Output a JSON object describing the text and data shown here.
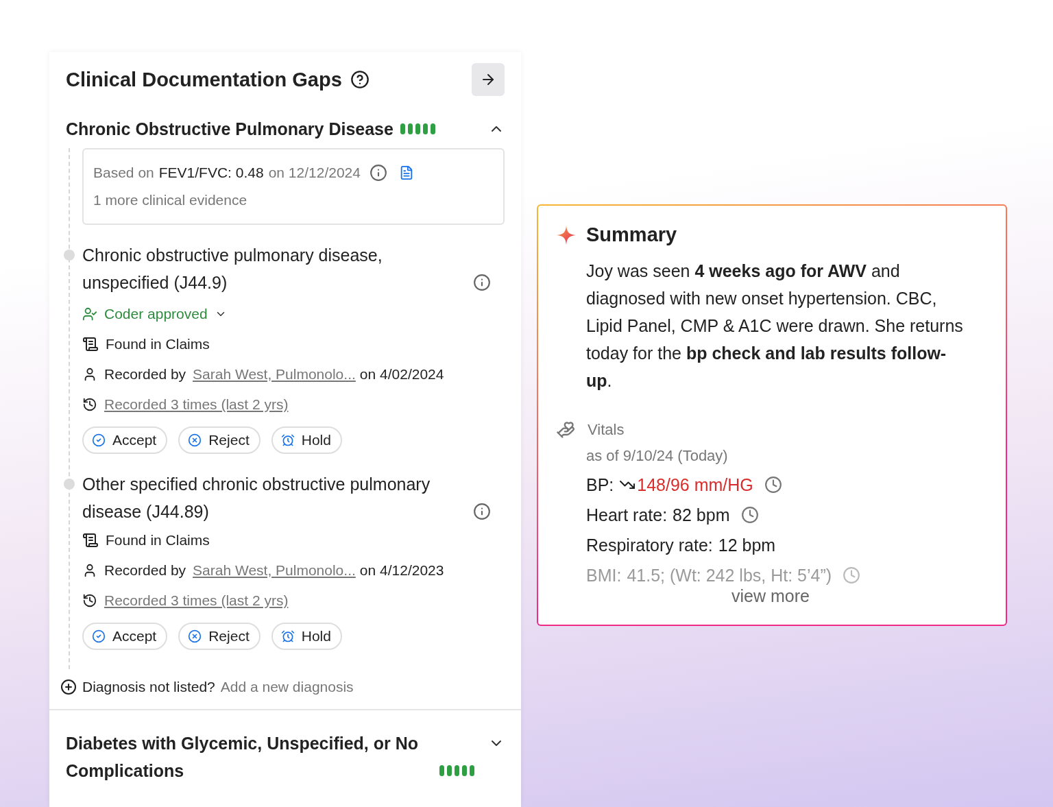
{
  "gaps_panel": {
    "title": "Clinical Documentation Gaps",
    "conditions": [
      {
        "name": "Chronic Obstructive Pulmonary Disease",
        "level": 1,
        "expanded": true,
        "evidence": {
          "prefix": "Based on",
          "value": "FEV1/FVC: 0.48",
          "suffix": "on 12/12/2024",
          "more": "1 more clinical evidence"
        },
        "diagnoses": [
          {
            "name": "Chronic obstructive pulmonary disease, unspecified (J44.9)",
            "status": "Coder approved",
            "source": "Found in Claims",
            "recorded_label": "Recorded by",
            "recorded_by": "Sarah West, Pulmonolo...",
            "recorded_on": "on 4/02/2024",
            "history": "Recorded 3 times (last 2 yrs)",
            "actions": [
              {
                "kind": "accept",
                "label": "Accept"
              },
              {
                "kind": "reject",
                "label": "Reject"
              },
              {
                "kind": "hold",
                "label": "Hold"
              }
            ]
          },
          {
            "name": "Other specified chronic obstructive pulmonary disease (J44.89)",
            "source": "Found in Claims",
            "recorded_label": "Recorded by",
            "recorded_by": "Sarah West, Pulmonolo...",
            "recorded_on": "on 4/12/2023",
            "history": "Recorded 3 times (last 2 yrs)",
            "actions": [
              {
                "kind": "accept",
                "label": "Accept"
              },
              {
                "kind": "reject",
                "label": "Reject"
              },
              {
                "kind": "hold",
                "label": "Hold"
              }
            ]
          }
        ],
        "add": {
          "prompt": "Diagnosis not listed?",
          "link": "Add a new diagnosis"
        }
      },
      {
        "name": "Diabetes with Glycemic, Unspecified, or No Complications",
        "level": 1,
        "expanded": false
      }
    ]
  },
  "summary": {
    "title": "Summary",
    "text": "Joy was seen **4 weeks ago for AWV** and diagnosed with new onset hypertension. CBC, Lipid Panel, CMP & A1C were drawn. She returns today for the **bp check and lab results follow-up**.",
    "vitals": {
      "label": "Vitals",
      "as_of": "as of 9/10/24 (Today)",
      "items": [
        {
          "label": "BP:",
          "value": "148/96 mm/HG",
          "trending_down": true,
          "alert": true,
          "history": true,
          "faded": false
        },
        {
          "label": "Heart rate:",
          "value": "82 bpm",
          "trending_down": false,
          "alert": false,
          "history": true,
          "faded": false
        },
        {
          "label": "Respiratory rate:",
          "value": "12 bpm",
          "trending_down": false,
          "alert": false,
          "history": false,
          "faded": false
        },
        {
          "label": "BMI:",
          "value": "41.5; (Wt: 242 lbs, Ht: 5’4”)",
          "trending_down": false,
          "alert": false,
          "history": true,
          "faded": true
        }
      ],
      "view_more": "view more"
    }
  }
}
